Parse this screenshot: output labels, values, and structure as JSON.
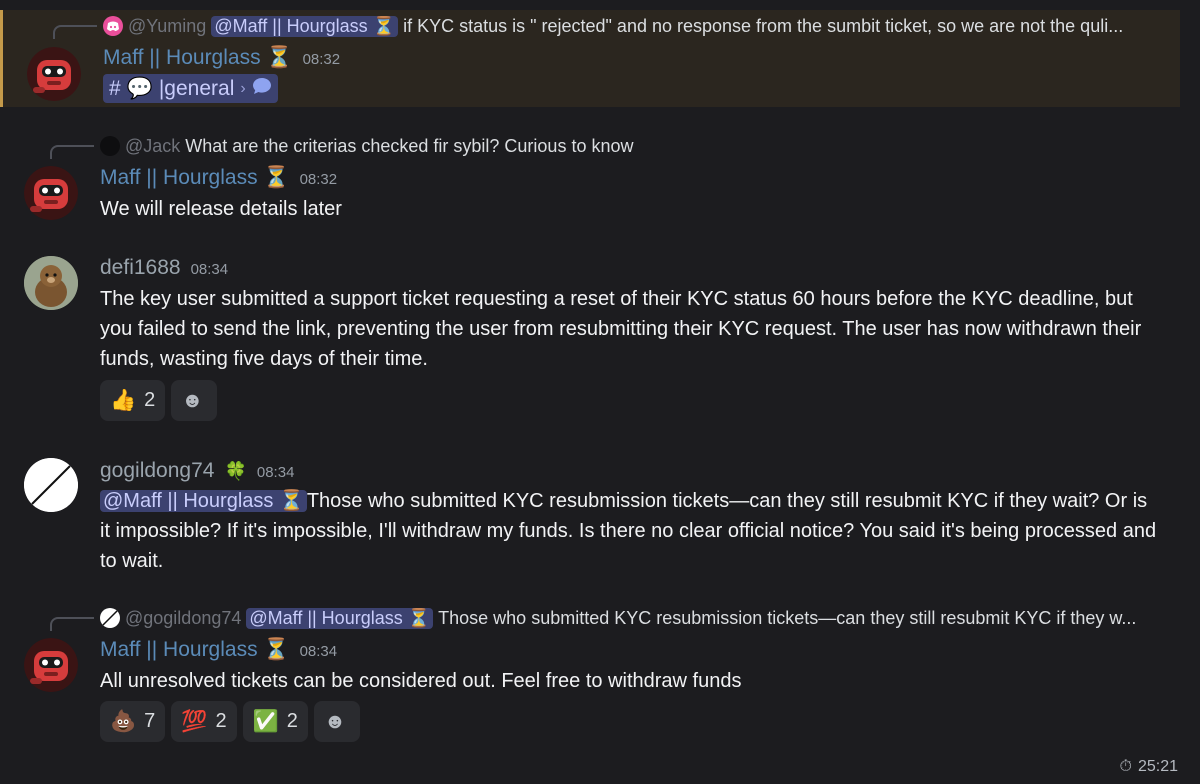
{
  "messages": [
    {
      "reply": {
        "handle": "@Yuming",
        "mention": "@Maff || Hourglass ⏳",
        "text": "if KYC status is \" rejected\" and no response from the sumbit ticket, so we are not the quli..."
      },
      "author": "Maff || Hourglass ⏳",
      "time": "08:32",
      "channel": {
        "hash": "#",
        "emoji": "💬",
        "name": "|general",
        "arrow": "›"
      }
    },
    {
      "reply": {
        "handle": "@Jack",
        "text": "What are the criterias checked fir sybil? Curious to know"
      },
      "author": "Maff || Hourglass ⏳",
      "time": "08:32",
      "text": "We will release details later"
    },
    {
      "author": "defi1688",
      "time": "08:34",
      "text": "The key user submitted a support ticket requesting a reset of their KYC status 60 hours before the KYC deadline, but you failed to send the link, preventing the user from resubmitting their KYC request. The user has now withdrawn their funds, wasting five days of their time.",
      "reactions": [
        {
          "emoji": "👍",
          "count": "2"
        },
        {
          "emoji": "☻",
          "count": ""
        }
      ]
    },
    {
      "author": "gogildong74",
      "badge": "🍀",
      "time": "08:34",
      "mention": "@Maff || Hourglass ⏳",
      "text": "Those who submitted KYC resubmission tickets—can they still resubmit KYC if they wait? Or is it impossible? If it's impossible, I'll withdraw my funds. Is there no clear official notice? You said it's being processed and to wait."
    },
    {
      "reply": {
        "handle": "@gogildong74",
        "mention": "@Maff || Hourglass ⏳",
        "text": "Those who submitted KYC resubmission tickets—can they still resubmit KYC if they w..."
      },
      "author": "Maff || Hourglass ⏳",
      "time": "08:34",
      "text": "All unresolved tickets can be considered out. Feel free to withdraw funds",
      "reactions": [
        {
          "emoji": "💩",
          "count": "7"
        },
        {
          "emoji": "💯",
          "count": "2"
        },
        {
          "emoji": "✅",
          "count": "2"
        },
        {
          "emoji": "☻",
          "count": ""
        }
      ]
    }
  ],
  "timer": {
    "icon": "⏱",
    "value": "25:21"
  },
  "colors": {
    "background": "#1c1c1f",
    "highlight": "#2b261f",
    "highlight_border": "#c49a4a",
    "username_mod": "#5b8bb8",
    "mention_bg": "#3c4270"
  }
}
